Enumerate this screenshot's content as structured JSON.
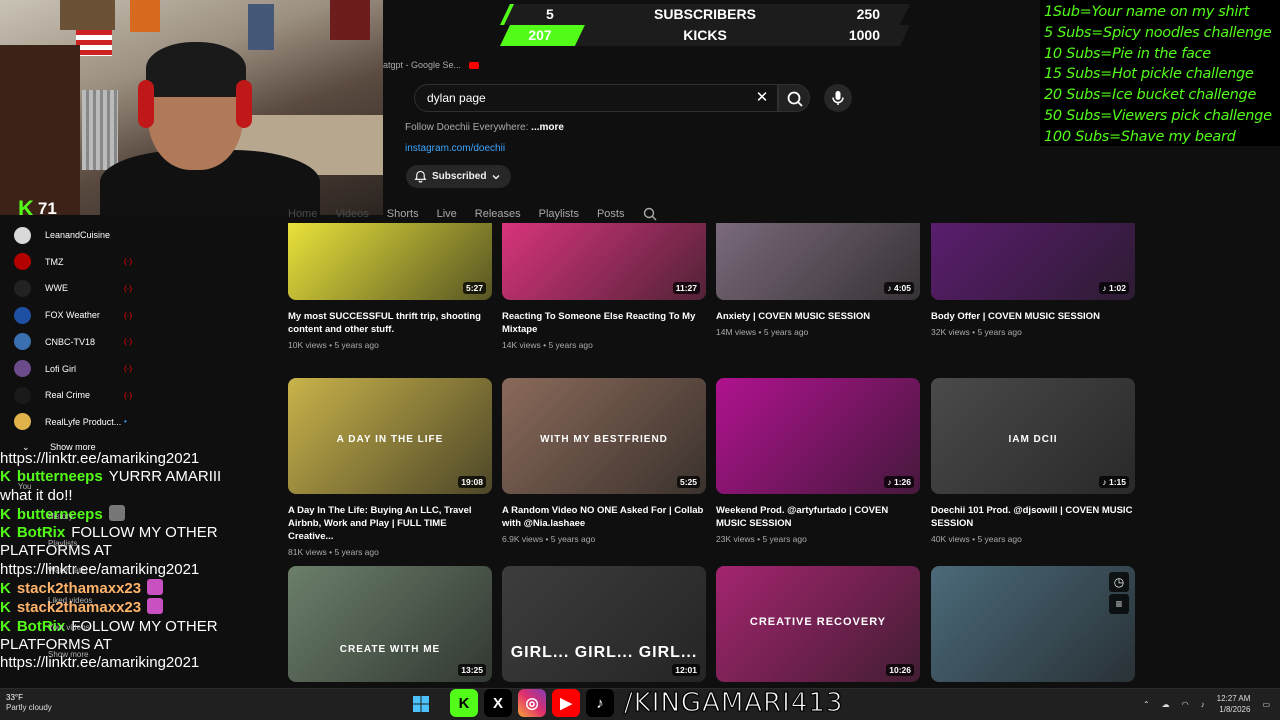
{
  "webcam": {
    "viewer_count": "71"
  },
  "scoreboard": {
    "subs_current": "5",
    "subs_label": "SUBSCRIBERS",
    "subs_goal": "250",
    "subs_progress": 0.02,
    "kicks_current": "207",
    "kicks_label": "KICKS",
    "kicks_goal": "1000",
    "kicks_progress": 0.207
  },
  "subgoals": [
    "1Sub=Your name on my shirt",
    "5 Subs=Spicy noodles challenge",
    "10 Subs=Pie in the face",
    "15 Subs=Hot pickle challenge",
    "20 Subs=Ice bucket challenge",
    "50 Subs=Viewers pick challenge",
    "100 Subs=Shave my beard"
  ],
  "youtube": {
    "tabstrip_text": "atgpt - Google Se...",
    "search_value": "dylan page",
    "follow_prefix": "Follow Doechii Everywhere: ",
    "follow_more": "...more",
    "ig_link": "instagram.com/doechii",
    "subscribed_label": "Subscribed",
    "tabs": [
      "Home",
      "Videos",
      "Shorts",
      "Live",
      "Releases",
      "Playlists",
      "Posts"
    ],
    "colors": {
      "accent_red": "#ff0000",
      "link_blue": "#3ea6ff",
      "bg": "#0f0f0f"
    }
  },
  "sidebar": {
    "items": [
      {
        "label": "LeanandCuisine",
        "live": false,
        "color": "#d9d9d9"
      },
      {
        "label": "TMZ",
        "live": true,
        "color": "#b30000"
      },
      {
        "label": "WWE",
        "live": true,
        "color": "#222222"
      },
      {
        "label": "FOX Weather",
        "live": true,
        "color": "#1f4fa3"
      },
      {
        "label": "CNBC-TV18",
        "live": true,
        "color": "#3a6fb0"
      },
      {
        "label": "Lofi Girl",
        "live": true,
        "color": "#6b4b8a"
      },
      {
        "label": "Real Crime",
        "live": true,
        "color": "#1a1a1a"
      },
      {
        "label": "RealLyfe Product...",
        "live": false,
        "color": "#e0b24a"
      }
    ],
    "show_more": "Show more",
    "ghost": [
      "You",
      "History",
      "Playlists",
      "Watch later",
      "Liked videos",
      "Your videos",
      "Show more"
    ]
  },
  "videos": [
    {
      "title": "My most SUCCESSFUL thrift trip, shooting content and other stuff.",
      "meta": "10K views • 5 years ago",
      "duration": "5:27",
      "bg": "#e9e23a",
      "caption": ""
    },
    {
      "title": "Reacting To Someone Else Reacting To My Mixtape",
      "meta": "14K views • 5 years ago",
      "duration": "11:27",
      "bg": "#d8347c",
      "caption": ""
    },
    {
      "title": "Anxiety | COVEN MUSIC SESSION",
      "meta": "14M views • 5 years ago",
      "duration": "4:05",
      "bg": "#7a6a7a",
      "caption": ""
    },
    {
      "title": "Body Offer | COVEN MUSIC SESSION",
      "meta": "32K views • 5 years ago",
      "duration": "1:02",
      "bg": "#5a1d6e",
      "caption": ""
    },
    {
      "title": "A Day In The Life: Buying An LLC, Travel Airbnb, Work and Play | FULL TIME Creative...",
      "meta": "81K views • 5 years ago",
      "duration": "19:08",
      "bg": "#c9b34a",
      "caption": "A DAY IN THE LIFE"
    },
    {
      "title": "A Random Video NO ONE Asked For | Collab with @Nia.lashaee",
      "meta": "6.9K views • 5 years ago",
      "duration": "5:25",
      "bg": "#8a6a5a",
      "caption": "WITH MY BESTFRIEND"
    },
    {
      "title": "Weekend Prod. @artyfurtado | COVEN MUSIC SESSION",
      "meta": "23K views • 5 years ago",
      "duration": "1:26",
      "bg": "#b0128f",
      "caption": ""
    },
    {
      "title": "Doechii 101 Prod. @djsowill | COVEN MUSIC SESSION",
      "meta": "40K views • 5 years ago",
      "duration": "1:15",
      "bg": "#4a4a4a",
      "caption": "IAM DCII"
    },
    {
      "title": "",
      "meta": "",
      "duration": "13:25",
      "bg": "#6b7f6a",
      "caption": "CREATE WITH ME"
    },
    {
      "title": "",
      "meta": "",
      "duration": "12:01",
      "bg": "#3d3d3d",
      "caption": "GIRL... GIRL... GIRL..."
    },
    {
      "title": "",
      "meta": "",
      "duration": "10:26",
      "bg": "#a4246f",
      "caption": "CREATIVE RECOVERY"
    },
    {
      "title": "",
      "meta": "",
      "duration": "",
      "bg": "#4b6a7a",
      "caption": ""
    }
  ],
  "chat": [
    {
      "user": "",
      "text": "https://linktr.ee/amariking2021",
      "k": false,
      "style": ""
    },
    {
      "user": "butterneeps",
      "text": "YURRR AMARIII",
      "k": true,
      "style": "green"
    },
    {
      "user": "",
      "text": "what it do!!",
      "k": false,
      "style": ""
    },
    {
      "user": "butterneeps",
      "text": "",
      "k": true,
      "style": "green"
    },
    {
      "user": "BotRix",
      "text": "FOLLOW MY OTHER",
      "k": true,
      "style": "green"
    },
    {
      "user": "",
      "text": "PLATFORMS AT",
      "k": false,
      "style": ""
    },
    {
      "user": "",
      "text": "https://linktr.ee/amariking2021",
      "k": false,
      "style": ""
    },
    {
      "user": "stack2thamaxx23",
      "text": "",
      "k": true,
      "style": "gold"
    },
    {
      "user": "stack2thamaxx23",
      "text": "",
      "k": true,
      "style": "gold"
    },
    {
      "user": "BotRix",
      "text": "FOLLOW MY OTHER",
      "k": true,
      "style": "green"
    },
    {
      "user": "",
      "text": "PLATFORMS AT",
      "k": false,
      "style": ""
    },
    {
      "user": "",
      "text": "https://linktr.ee/amariking2021",
      "k": false,
      "style": ""
    }
  ],
  "taskbar": {
    "weather_temp": "33°F",
    "weather_text": "Partly cloudy",
    "handle": "/KINGAMARI413",
    "time": "12:27 AM",
    "date": "1/8/2026"
  }
}
